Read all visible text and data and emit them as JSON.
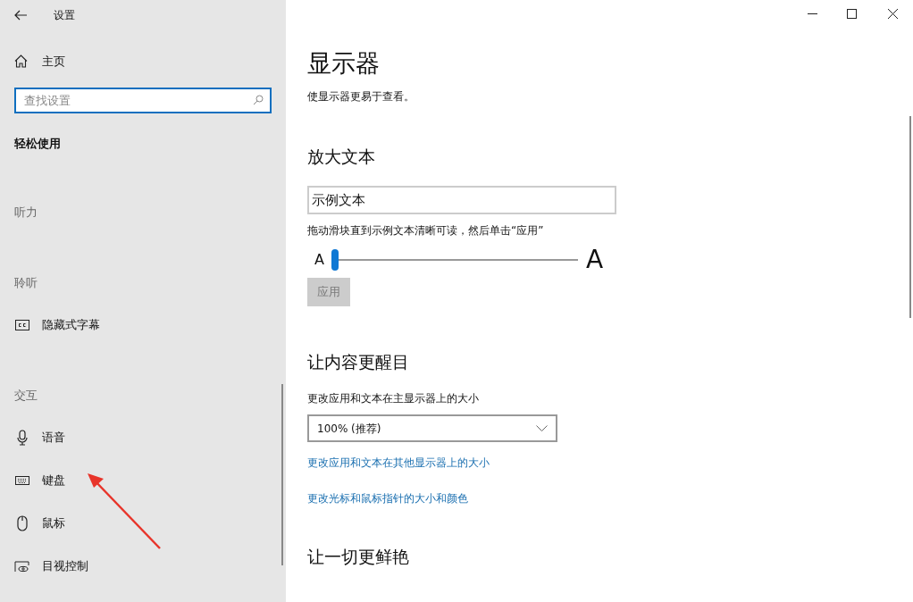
{
  "window": {
    "title": "设置"
  },
  "sidebar": {
    "home": "主页",
    "search": {
      "placeholder": "查找设置"
    },
    "items": [
      {
        "kind": "section",
        "label": "轻松使用"
      },
      {
        "kind": "group",
        "label": "听力"
      },
      {
        "kind": "group",
        "label": "聆听"
      },
      {
        "kind": "nav",
        "label": "隐藏式字幕"
      },
      {
        "kind": "group",
        "label": "交互"
      },
      {
        "kind": "nav",
        "label": "语音"
      },
      {
        "kind": "nav",
        "label": "键盘"
      },
      {
        "kind": "nav",
        "label": "鼠标"
      },
      {
        "kind": "nav",
        "label": "目视控制"
      }
    ]
  },
  "main": {
    "title": "显示器",
    "subtitle": "使显示器更易于查看。",
    "enlarge": {
      "heading": "放大文本",
      "sample": "示例文本",
      "hint": "拖动滑块直到示例文本清晰可读，然后单击“应用”",
      "small_a": "A",
      "large_a": "A",
      "slider": {
        "level": 0.0
      },
      "apply": {
        "label": "应用",
        "disabled": true
      }
    },
    "prominent": {
      "heading": "让内容更醒目",
      "label": "更改应用和文本在主显示器上的大小",
      "dropdown": "100% (推荐)",
      "links": [
        "更改应用和文本在其他显示器上的大小",
        "更改光标和鼠标指针的大小和颜色"
      ]
    },
    "vivid": {
      "heading": "让一切更鲜艳"
    }
  }
}
